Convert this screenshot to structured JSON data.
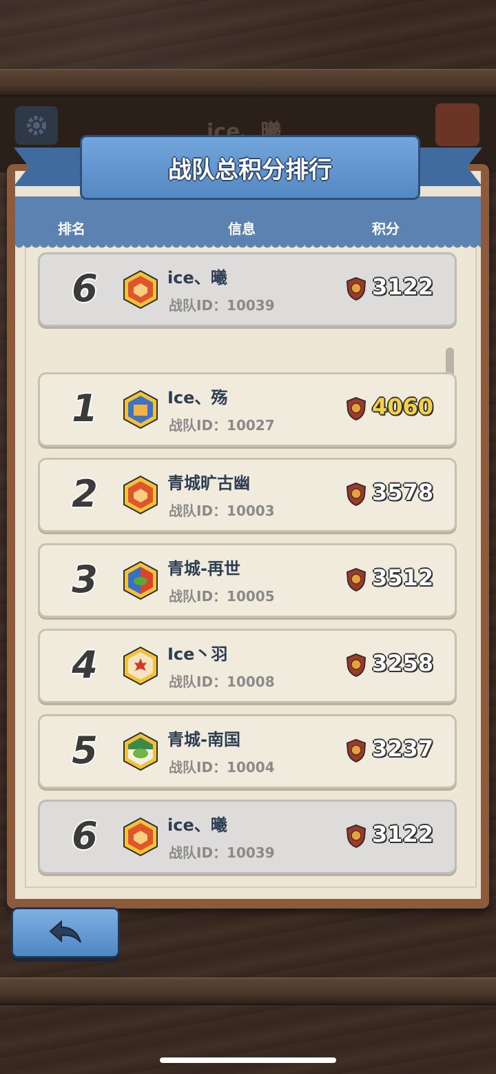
{
  "background_title": "ice、曦",
  "title": "战队总积分排行",
  "columns": {
    "rank": "排名",
    "info": "信息",
    "score": "积分"
  },
  "my_entry": {
    "rank": "6",
    "name": "ice、曦",
    "id": "战队ID：10039",
    "score": "3122"
  },
  "entries": [
    {
      "rank": "1",
      "name": "Ice、殇",
      "id": "战队ID：10027",
      "score": "4060",
      "emblem": "blue-crest-icon"
    },
    {
      "rank": "2",
      "name": "青城旷古幽",
      "id": "战队ID：10003",
      "score": "3578",
      "emblem": "orange-crest-icon"
    },
    {
      "rank": "3",
      "name": "青城-再世",
      "id": "战队ID：10005",
      "score": "3512",
      "emblem": "blue-red-leaf-crest-icon"
    },
    {
      "rank": "4",
      "name": "Ice丶羽",
      "id": "战队ID：10008",
      "score": "3258",
      "emblem": "maple-leaf-crest-icon"
    },
    {
      "rank": "5",
      "name": "青城-南国",
      "id": "战队ID：10004",
      "score": "3237",
      "emblem": "green-leaf-crest-icon"
    },
    {
      "rank": "6",
      "name": "ice、曦",
      "id": "战队ID：10039",
      "score": "3122",
      "emblem": "orange-crest-icon"
    }
  ],
  "colors": {
    "header_blue": "#5b82b0",
    "gold_score": "#f5d04a",
    "paper": "#ece4d3"
  }
}
